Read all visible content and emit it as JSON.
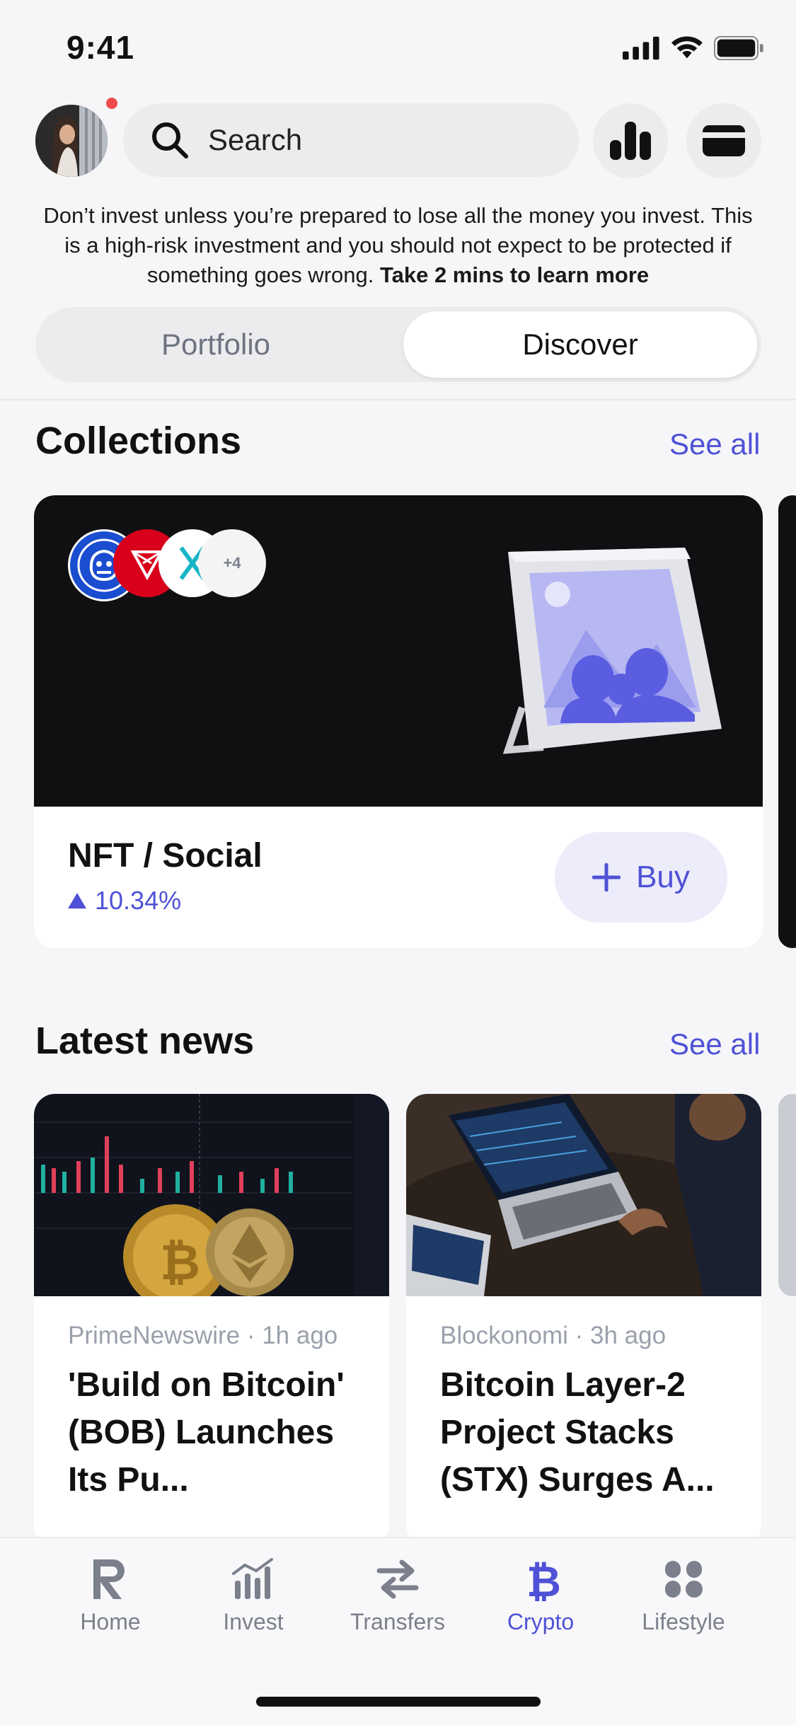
{
  "status_bar": {
    "time": "9:41"
  },
  "header": {
    "search_placeholder": "Search"
  },
  "disclaimer": {
    "text": "Don’t invest unless you’re prepared to lose all the money you invest. This is a high-risk investment and you should not expect to be protected if something goes wrong.",
    "link": "Take 2 mins to learn more"
  },
  "segments": {
    "portfolio": "Portfolio",
    "discover": "Discover"
  },
  "collections": {
    "title": "Collections",
    "see_all": "See all",
    "card": {
      "coins_extra": "+4",
      "name": "NFT / Social",
      "change": "10.34%",
      "buy_label": "Buy"
    }
  },
  "news": {
    "title": "Latest news",
    "see_all": "See all",
    "items": [
      {
        "source": "PrimeNewswire",
        "time": "1h ago",
        "headline": "'Build on Bitcoin' (BOB) Launches Its Pu..."
      },
      {
        "source": "Blockonomi",
        "time": "3h ago",
        "headline": "Bitcoin Layer-2 Project Stacks (STX) Surges A..."
      }
    ]
  },
  "tabbar": {
    "items": [
      {
        "label": "Home",
        "icon": "revolut-r-icon"
      },
      {
        "label": "Invest",
        "icon": "bar-chart-icon"
      },
      {
        "label": "Transfers",
        "icon": "transfer-arrows-icon"
      },
      {
        "label": "Crypto",
        "icon": "bitcoin-icon",
        "active": true
      },
      {
        "label": "Lifestyle",
        "icon": "lifestyle-icon"
      }
    ]
  },
  "colors": {
    "accent": "#4f52d6",
    "dark": "#101012",
    "muted": "#7b808c"
  }
}
